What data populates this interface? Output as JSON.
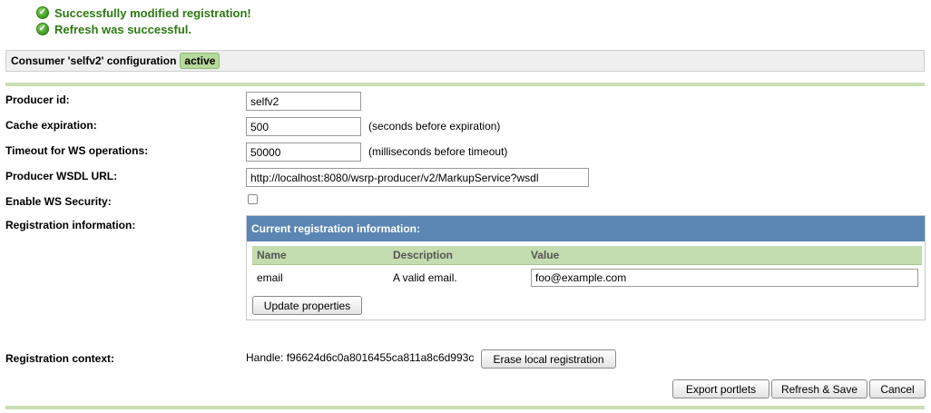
{
  "messages": [
    {
      "icon": "check-circle-icon",
      "text": "Successfully modified registration!"
    },
    {
      "icon": "check-circle-icon",
      "text": "Refresh was successful."
    }
  ],
  "header": {
    "title": "Consumer 'selfv2' configuration",
    "status": "active"
  },
  "form": {
    "producer_id": {
      "label": "Producer id:",
      "value": "selfv2"
    },
    "cache_expiration": {
      "label": "Cache expiration:",
      "value": "500",
      "hint": "(seconds before expiration)"
    },
    "timeout": {
      "label": "Timeout for WS operations:",
      "value": "50000",
      "hint": "(milliseconds before timeout)"
    },
    "wsdl_url": {
      "label": "Producer WSDL URL:",
      "value": "http://localhost:8080/wsrp-producer/v2/MarkupService?wsdl"
    },
    "ws_security": {
      "label": "Enable WS Security:",
      "checked": false
    },
    "registration_info_label": "Registration information:"
  },
  "registration": {
    "panel_title": "Current registration information:",
    "columns": [
      "Name",
      "Description",
      "Value"
    ],
    "rows": [
      {
        "name": "email",
        "description": "A valid email.",
        "value": "foo@example.com"
      }
    ],
    "update_button": "Update properties"
  },
  "context": {
    "label": "Registration context:",
    "handle": "Handle: f96624d6c0a8016455ca811a8c6d993c",
    "erase_button": "Erase local registration"
  },
  "actions": {
    "export": "Export portlets",
    "refresh_save": "Refresh & Save",
    "cancel": "Cancel"
  },
  "colors": {
    "success_text": "#2c7a12",
    "panel_header": "#5b86b4",
    "table_header": "#c4ddb0",
    "active_badge": "#b6d99c"
  }
}
